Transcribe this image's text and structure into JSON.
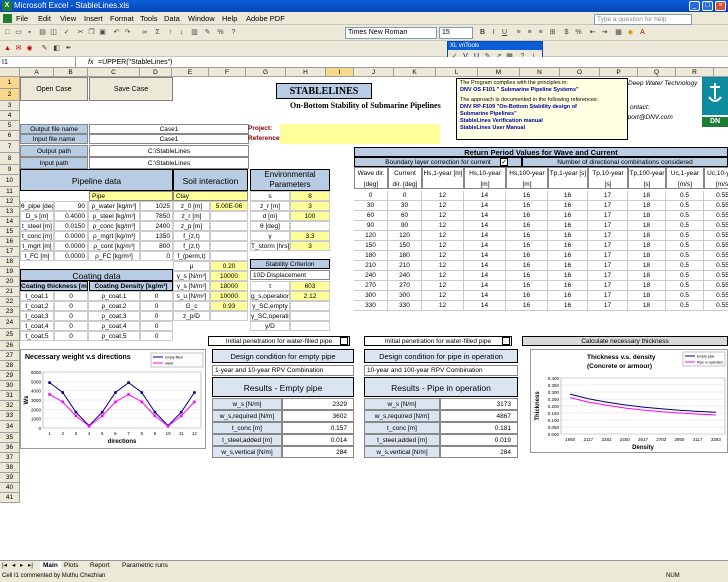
{
  "window": {
    "title": "Microsoft Excel - StableLines.xls",
    "app_icon": "excel-icon"
  },
  "menu": [
    "File",
    "Edit",
    "View",
    "Insert",
    "Format",
    "Tools",
    "Data",
    "Window",
    "Help",
    "Adobe PDF"
  ],
  "help_box": {
    "placeholder": "Type a question for help"
  },
  "font": {
    "name": "Times New Roman",
    "size": "15"
  },
  "xlvntools": {
    "title": "XL vnTools"
  },
  "formula": {
    "namebox": "I1",
    "fx": "fx",
    "content": "=UPPER(\"StableLines\")"
  },
  "columns": [
    "A",
    "B",
    "C",
    "D",
    "E",
    "F",
    "G",
    "H",
    "I",
    "J",
    "K",
    "L",
    "M",
    "N",
    "O",
    "P",
    "Q",
    "R",
    "S"
  ],
  "rows": [
    "1",
    "2",
    "3",
    "4",
    "5",
    "6",
    "7",
    "8",
    "9",
    "10",
    "11",
    "12",
    "13",
    "14",
    "15",
    "16",
    "17",
    "18",
    "19",
    "20",
    "21",
    "22",
    "23",
    "24",
    "25",
    "26",
    "27",
    "28",
    "29",
    "30",
    "31",
    "32",
    "33",
    "34",
    "35",
    "36",
    "37",
    "38",
    "39",
    "40",
    "41"
  ],
  "buttons": {
    "open": "Open Case",
    "save": "Save Case"
  },
  "title": {
    "main": "STABLELINES",
    "sub": "On-Bottom Stability of Submarine Pipelines",
    "deep": "Deep Water Technology",
    "contact": "ontact:",
    "email": "pport@DNV.com"
  },
  "popup": {
    "l1": "The Program complies with the principles in:",
    "l2": "DNV OS F101 \" Submarine Pipeline Systems\"",
    "l3": "The approach is documented in the following references:",
    "l4": "DNV RP-F109 \"On-Bottom Stability design of",
    "l5": "Submarine Pipelines\"",
    "l6": "StableLines Verification manual",
    "l7": "StableLines User Manual"
  },
  "files": {
    "output_file": "Output file name",
    "output_file_val": "Case1",
    "input_file": "Input file name",
    "input_file_val": "Case1",
    "output_path": "Output path",
    "output_path_val": "C:\\StableLines",
    "input_path": "Input path",
    "input_path_val": "C:\\StableLines",
    "project": "Project:",
    "references": "References:"
  },
  "sections": {
    "pipeline": "Pipeline data",
    "soil": "Soil interaction",
    "env": "Environmental Parameters",
    "return": "Return Period Values for Wave and Current",
    "boundary": "Boundary layer correction for current",
    "ndir": "Number of directional combinations considered",
    "stability": "Stability Criterion",
    "coating": "Coating data"
  },
  "pipeline": {
    "type": "Pipe",
    "rows": [
      {
        "l": "θ_pipe [deg]",
        "v": "90",
        "l2": "ρ_water [kg/m³]",
        "v2": "1025"
      },
      {
        "l": "D_s [m]",
        "v": "0.4000",
        "l2": "ρ_steel [kg/m³]",
        "v2": "7850"
      },
      {
        "l": "t_steel [m]",
        "v": "0.0150",
        "l2": "ρ_conc [kg/m³]",
        "v2": "2400"
      },
      {
        "l": "t_conc [m]",
        "v": "0.0000",
        "l2": "ρ_mgrt [kg/m³]",
        "v2": "1350"
      },
      {
        "l": "t_mgrt [m]",
        "v": "0.0000",
        "l2": "ρ_cont [kg/m³]",
        "v2": "800"
      },
      {
        "l": "t_FC [m]",
        "v": "0.0000",
        "l2": "ρ_FC [kg/m³]",
        "v2": "0"
      }
    ]
  },
  "soil": {
    "type": "Clay",
    "rows": [
      {
        "l": "z_0 [m]",
        "v": "5.00E-06"
      },
      {
        "l": "z_r [m]",
        "v": ""
      },
      {
        "l": "z_p [m]",
        "v": ""
      },
      {
        "l": "f_(z,t)",
        "v": ""
      },
      {
        "l": "f_(z,t)",
        "v": ""
      },
      {
        "l": "f_(perm,t)",
        "v": ""
      },
      {
        "l": "μ",
        "v": "0.20"
      },
      {
        "l": "γ_s [N/m³]",
        "v": "10000"
      },
      {
        "l": "γ_s [N/m³]",
        "v": "18000"
      },
      {
        "l": "s_u [N/m²]",
        "v": "10000"
      },
      {
        "l": "G_c",
        "v": "0.93"
      },
      {
        "l": "z_p/D",
        "v": ""
      }
    ]
  },
  "env": {
    "rows": [
      {
        "l": "s",
        "v": "8"
      },
      {
        "l": "z_r [m]",
        "v": "3"
      },
      {
        "l": "d [m]",
        "v": "100"
      },
      {
        "l": "θ [deg]",
        "v": ""
      },
      {
        "l": "γ",
        "v": "3.3"
      },
      {
        "l": "T_storm [hrs]",
        "v": "3"
      }
    ],
    "criterion": "10D Displacement",
    "rows2": [
      {
        "l": "τ",
        "v": "603"
      },
      {
        "l": "g_s,operation",
        "v": "2.12"
      },
      {
        "l": "γ_SC,empty",
        "v": ""
      },
      {
        "l": "γ_SC,operation",
        "v": ""
      },
      {
        "l": "y/D",
        "v": ""
      }
    ]
  },
  "return_headers": [
    "Wave dir. [deg]",
    "Current dir. [deg]",
    "Hs,1-year [m]",
    "Hs,10-year [m]",
    "Hs,100-year [m]",
    "Tp,1-year [s]",
    "Tp,10-year [s]",
    "Tp,100-year [s]",
    "Uc,1-year [m/s]",
    "Uc,10-year [m/s]",
    "Uc"
  ],
  "return_rows": [
    [
      "0",
      "0",
      "12",
      "14",
      "16",
      "16",
      "17",
      "18",
      "0.5",
      "0.55"
    ],
    [
      "30",
      "30",
      "12",
      "14",
      "16",
      "16",
      "17",
      "18",
      "0.5",
      "0.55"
    ],
    [
      "60",
      "60",
      "12",
      "14",
      "16",
      "16",
      "17",
      "18",
      "0.5",
      "0.55"
    ],
    [
      "90",
      "90",
      "12",
      "14",
      "16",
      "16",
      "17",
      "18",
      "0.5",
      "0.55"
    ],
    [
      "120",
      "120",
      "12",
      "14",
      "16",
      "16",
      "17",
      "18",
      "0.5",
      "0.55"
    ],
    [
      "150",
      "150",
      "12",
      "14",
      "16",
      "16",
      "17",
      "18",
      "0.5",
      "0.55"
    ],
    [
      "180",
      "180",
      "12",
      "14",
      "16",
      "16",
      "17",
      "18",
      "0.5",
      "0.55"
    ],
    [
      "210",
      "210",
      "12",
      "14",
      "16",
      "16",
      "17",
      "18",
      "0.5",
      "0.55"
    ],
    [
      "240",
      "240",
      "12",
      "14",
      "16",
      "16",
      "17",
      "18",
      "0.5",
      "0.55"
    ],
    [
      "270",
      "270",
      "12",
      "14",
      "16",
      "16",
      "17",
      "18",
      "0.5",
      "0.55"
    ],
    [
      "300",
      "300",
      "12",
      "14",
      "16",
      "16",
      "17",
      "18",
      "0.5",
      "0.55"
    ],
    [
      "330",
      "330",
      "12",
      "14",
      "16",
      "16",
      "17",
      "18",
      "0.5",
      "0.55"
    ]
  ],
  "coating": {
    "h1": "Coating thickness [m]",
    "h2": "Coating Density [kg/m³]",
    "rows": [
      {
        "l": "t_coat,1",
        "v": "0",
        "l2": "ρ_coat,1",
        "v2": "0"
      },
      {
        "l": "t_coat,2",
        "v": "0",
        "l2": "ρ_coat,2",
        "v2": "0"
      },
      {
        "l": "t_coat,3",
        "v": "0",
        "l2": "ρ_coat,3",
        "v2": "0"
      },
      {
        "l": "t_coat,4",
        "v": "0",
        "l2": "ρ_coat,4",
        "v2": "0"
      },
      {
        "l": "t_coat,5",
        "v": "0",
        "l2": "ρ_coat,5",
        "v2": "0"
      }
    ]
  },
  "penetration": {
    "empty": "Initial penetration for water-filled pipe",
    "oper": "Initial penetration for water-filled pipe",
    "calc": "Calculate necessary thickness"
  },
  "design": {
    "empty": "Design condition for empty pipe",
    "empty_sel": "1-year and 10-year RPV Combination",
    "oper": "Design condition for pipe in operation",
    "oper_sel": "10-year and 100-year RPV Combination"
  },
  "results_empty": {
    "title": "Results - Empty pipe",
    "rows": [
      {
        "l": "w_s [N/m]",
        "v": "2329"
      },
      {
        "l": "w_s,required [N/m]",
        "v": "3602"
      },
      {
        "l": "t_conc [m]",
        "v": "0.157"
      },
      {
        "l": "t_steel,added [m]",
        "v": "0.014"
      },
      {
        "l": "w_s,vertical [N/m]",
        "v": "284"
      }
    ]
  },
  "results_oper": {
    "title": "Results - Pipe in operation",
    "rows": [
      {
        "l": "w_s [N/m]",
        "v": "3173"
      },
      {
        "l": "w_s,required [N/m]",
        "v": "4867"
      },
      {
        "l": "t_conc [m]",
        "v": "0.181"
      },
      {
        "l": "t_steel,added [m]",
        "v": "0.019"
      },
      {
        "l": "w_s,vertical [N/m]",
        "v": "284"
      }
    ]
  },
  "chart_data": [
    {
      "type": "line",
      "title": "Necessary weight v.s directions",
      "xlabel": "directions",
      "ylabel": "Ws",
      "x": [
        1,
        2,
        3,
        4,
        5,
        6,
        7,
        8,
        9,
        10,
        11,
        12
      ],
      "ylim": [
        0,
        6000
      ],
      "yticks": [
        "0",
        "1000",
        "2000",
        "3000",
        "4000",
        "5000",
        "6000"
      ],
      "series": [
        {
          "name": "empty-filled",
          "color": "#000080",
          "values": [
            4860,
            3800,
            1700,
            250,
            1700,
            3800,
            4860,
            3800,
            1700,
            250,
            1700,
            3800
          ]
        },
        {
          "name": "water",
          "color": "#ff00ff",
          "values": [
            3600,
            2800,
            1300,
            200,
            1300,
            2800,
            3600,
            2800,
            1300,
            200,
            1300,
            2800
          ]
        }
      ]
    },
    {
      "type": "line",
      "title": "Thickness v.s. density",
      "subtitle": "(Concrete or armour)",
      "xlabel": "Density",
      "ylabel": "Thickness",
      "x": [
        "1950",
        "2117",
        "2283",
        "2450",
        "2617",
        "2783",
        "2950",
        "3117",
        "3283"
      ],
      "ylim": [
        0,
        0.4
      ],
      "yticks": [
        "0.000",
        "0.050",
        "0.100",
        "0.150",
        "0.200",
        "0.250",
        "0.300",
        "0.350",
        "0.400"
      ],
      "series": [
        {
          "name": "Empty pipe",
          "color": "#000080",
          "values": [
            0.285,
            0.252,
            0.228,
            0.208,
            0.192,
            0.18,
            0.17,
            0.162,
            0.155
          ]
        },
        {
          "name": "Pipe in operation",
          "color": "#ff00ff",
          "values": [
            0.26,
            0.228,
            0.205,
            0.186,
            0.171,
            0.159,
            0.15,
            0.142,
            0.136
          ]
        }
      ]
    }
  ],
  "tabs": [
    "Main",
    "Plots",
    "Report",
    "Parametric runs"
  ],
  "statusbar": {
    "comment": "Cell I1 commented by Muthu Chezhian",
    "num": "NUM"
  }
}
